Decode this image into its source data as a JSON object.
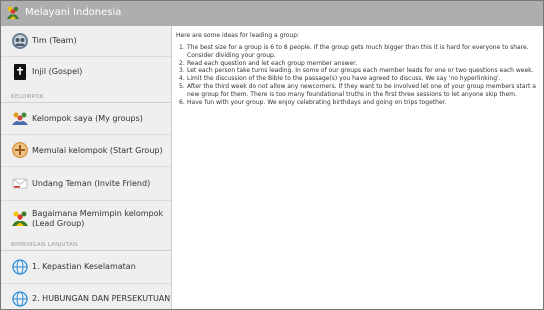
{
  "app": {
    "title": "Melayani Indonesia"
  },
  "sidebar": {
    "items_top": [
      {
        "label": "Tim (Team)",
        "icon": "team-icon"
      },
      {
        "label": "Injil (Gospel)",
        "icon": "bible-icon"
      }
    ],
    "sections": [
      {
        "header": "KELOMPOK",
        "items": [
          {
            "label": "Kelompok saya (My groups)",
            "icon": "group-icon"
          },
          {
            "label": "Memulai kelompok (Start Group)",
            "icon": "add-icon"
          },
          {
            "label": "Undang Teman (Invite Friend)",
            "icon": "mail-icon"
          },
          {
            "label": "Bagaimana Memimpin kelompok",
            "sublabel": "(Lead Group)",
            "icon": "leader-icon"
          }
        ]
      },
      {
        "header": "BIMBINGAN LANJUTAN",
        "items": [
          {
            "label": "1. Kepastian Keselamatan",
            "icon": "globe-icon"
          },
          {
            "label": "2. HUBUNGAN DAN PERSEKUTUAN",
            "icon": "globe-icon"
          }
        ]
      }
    ]
  },
  "content": {
    "intro": "Here are some ideas for leading a group:",
    "ideas": [
      {
        "num": "1.",
        "text": "The best size for a group is 6 to 8 people.  If the group gets much bigger than this it is hard for everyone to share. Consider dividing your group."
      },
      {
        "num": "2.",
        "text": "Read each question and let each group member answer."
      },
      {
        "num": "3.",
        "text": "Let each person take turns leading.  In some of our groups each member leads for one or two questions each week."
      },
      {
        "num": "4.",
        "text": "Limit the discussion of the Bible to the passage(s) you have agreed to discuss.  We say 'no hyperlinking'."
      },
      {
        "num": "5.",
        "text": "After the third week do not allow any newcomers.  If they want to be involved let one of your group members start a new group for them.  There is too many foundational truths in the first three sessions to let anyone skip them."
      },
      {
        "num": "6.",
        "text": "Have fun with your group.  We enjoy celebrating birthdays and going on trips together."
      }
    ]
  },
  "colors": {
    "action_bar": "#aeaeae",
    "sidebar_bg": "#efefef",
    "content_bg": "#ffffff",
    "text": "#333333",
    "section_header": "#9a9a9a"
  }
}
